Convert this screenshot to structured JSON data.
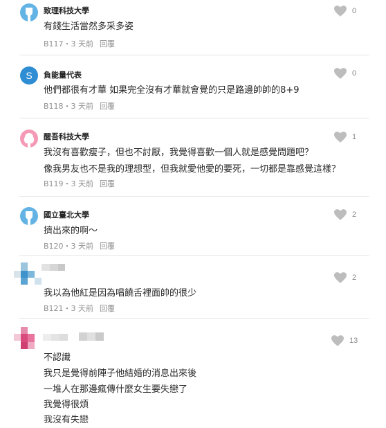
{
  "comments": [
    {
      "author": "致理科技大學",
      "lines": [
        "有錢生活當然多采多姿"
      ],
      "floor": "B117",
      "time": "3 天前",
      "reply": "回覆",
      "likes": "0",
      "avatar": "school-avatar-icon"
    },
    {
      "author": "負能量代表",
      "avatar_letter": "S",
      "lines": [
        "他們都很有才華 如果完全沒有才華就會覺的只是路邊帥帥的8+9"
      ],
      "floor": "B118",
      "time": "3 天前",
      "reply": "回覆",
      "likes": "0",
      "avatar": "letter-avatar"
    },
    {
      "author": "醒吾科技大學",
      "lines": [
        "我沒有喜歡瘦子，但也不討厭，我覺得喜歡一個人就是感覺問題吧？",
        "像我男友也不是我的理想型，但我就愛他愛的要死，一切都是靠感覺這樣？"
      ],
      "floor": "B119",
      "time": "3 天前",
      "reply": "回覆",
      "likes": "1",
      "avatar": "female-avatar-icon"
    },
    {
      "author": "國立臺北大學",
      "lines": [
        "擠出來的啊～"
      ],
      "floor": "B120",
      "time": "3 天前",
      "reply": "回覆",
      "likes": "2",
      "avatar": "school-avatar-icon"
    },
    {
      "author": "",
      "lines": [
        "我以為他紅是因為唱饒舌裡面帥的很少"
      ],
      "floor": "B121",
      "time": "3 天前",
      "reply": "回覆",
      "likes": "2",
      "avatar": "pixelated-avatar"
    },
    {
      "author": "",
      "lines": [
        "不認識",
        "我只是覺得前陣子他結婚的消息出來後",
        "一堆人在那邊瘋傳什麼女生要失戀了",
        "我覺得很煩",
        "我沒有失戀"
      ],
      "likes": "13",
      "avatar": "pixelated-avatar"
    }
  ],
  "separator": "・",
  "colors": {
    "heart": "#bdbdbd",
    "school_avatar": "#63b4e4",
    "letter_avatar": "#2f8dd3",
    "pink_avatar": "#f59ab6"
  }
}
